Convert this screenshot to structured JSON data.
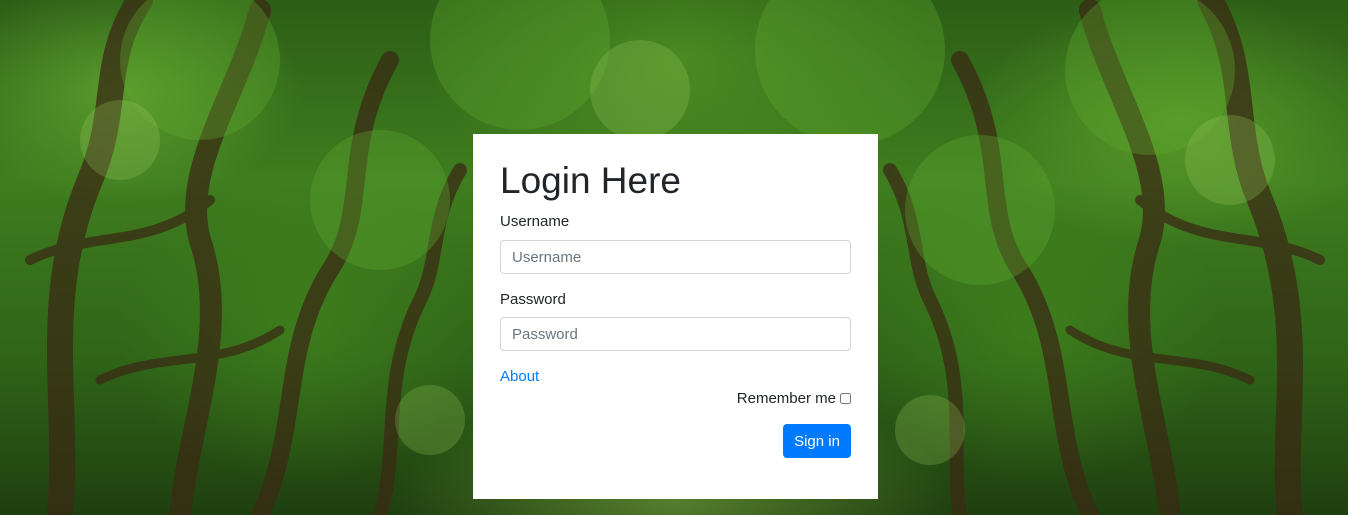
{
  "background": {
    "description_icon": "forest-background"
  },
  "login": {
    "title": "Login Here",
    "username_label": "Username",
    "username_placeholder": "Username",
    "username_value": "",
    "password_label": "Password",
    "password_placeholder": "Password",
    "password_value": "",
    "about_link": "About",
    "remember_label": "Remember me",
    "remember_checked": false,
    "signin_label": "Sign in"
  },
  "colors": {
    "primary": "#007bff",
    "card": "#ffffff",
    "text": "#212529"
  }
}
